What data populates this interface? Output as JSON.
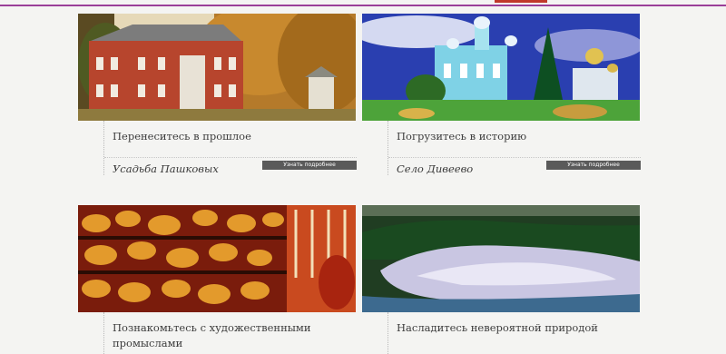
{
  "cards": [
    {
      "title": "Перенеситесь в прошлое",
      "place": "Усадьба Пашковых",
      "button": "Узнать подробнее",
      "image": "red-brick-manor-autumn-photo"
    },
    {
      "title": "Погрузитесь в историю",
      "place": "Село Дивеево",
      "button": "Узнать подробнее",
      "image": "blue-monastery-cathedral-photo"
    },
    {
      "title": "Познакомьтесь с художественными промыслами",
      "image": "painted-wooden-crafts-photo"
    },
    {
      "title": "Насладитесь невероятной природой",
      "image": "forest-lake-aerial-photo"
    }
  ],
  "colors": {
    "accent_line": "#9a3f98",
    "button_bg": "#5a5a5a",
    "background": "#f4f4f2"
  }
}
